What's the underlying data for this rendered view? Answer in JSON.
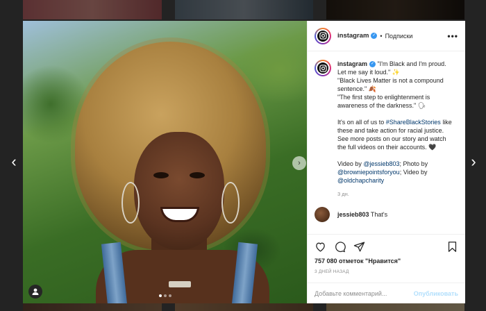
{
  "post": {
    "author": "instagram",
    "follow_label": "Подписки",
    "separator": "•",
    "more_label": "•••",
    "verified_mark": "✓",
    "caption": {
      "line1": " \"I'm Black and I'm proud. Let me say it loud.\" ✨",
      "line2": "\"Black Lives Matter is not a compound sentence.\" 🍂",
      "line3": "\"The first step to enlightenment is awareness of the darkness.\" 🗣",
      "line4_pre": "It's on all of us to ",
      "hashtag": "#ShareBlackStories",
      "line4_post": " like these and take action for racial justice. See more posts on our story and watch the full videos on their accounts. 🖤",
      "video_by_label": "Video by ",
      "credit1": "@jessieb803",
      "photo_by_label": "; Photo by ",
      "credit2": "@browniepointsforyou",
      "video_by_label2": "; Video by ",
      "credit3": "@oldchapcharity",
      "time": "3 дн."
    },
    "reply": {
      "author": "jessieb803",
      "text": "That's"
    },
    "likes": "757 080 отметок \"Нравится\"",
    "date": "3 ДНЕЙ НАЗАД",
    "comment_placeholder": "Добавьте комментарий...",
    "publish_label": "Опубликовать"
  },
  "nav": {
    "prev_label": "‹",
    "next_label": "›",
    "media_next_label": "›"
  },
  "icons": {
    "like": "heart-icon",
    "comment": "comment-icon",
    "share": "share-icon",
    "save": "bookmark-icon",
    "user_tag": "user-tag-icon"
  },
  "colors": {
    "link": "#00376b",
    "verified": "#3897f0",
    "publish_disabled": "#b2dffc"
  },
  "carousel": {
    "slides": 3,
    "active": 1
  }
}
